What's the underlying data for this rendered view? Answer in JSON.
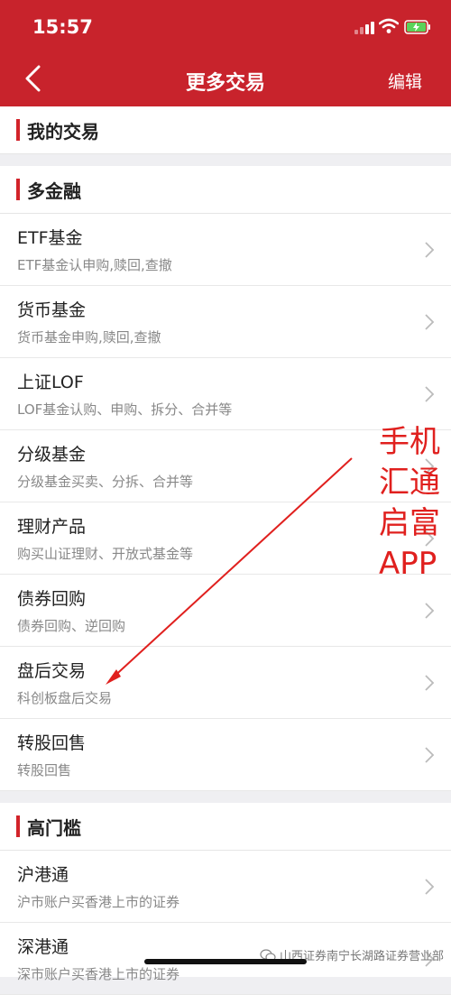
{
  "status_bar": {
    "time": "15:57"
  },
  "nav": {
    "title": "更多交易",
    "edit_label": "编辑"
  },
  "sections": [
    {
      "title": "我的交易",
      "items": []
    },
    {
      "title": "多金融",
      "items": [
        {
          "name": "ETF基金",
          "desc": "ETF基金认申购,赎回,查撤"
        },
        {
          "name": "货币基金",
          "desc": "货币基金申购,赎回,查撤"
        },
        {
          "name": "上证LOF",
          "desc": "LOF基金认购、申购、拆分、合并等"
        },
        {
          "name": "分级基金",
          "desc": "分级基金买卖、分拆、合并等"
        },
        {
          "name": "理财产品",
          "desc": "购买山证理财、开放式基金等"
        },
        {
          "name": "债券回购",
          "desc": "债券回购、逆回购"
        },
        {
          "name": "盘后交易",
          "desc": "科创板盘后交易"
        },
        {
          "name": "转股回售",
          "desc": "转股回售"
        }
      ]
    },
    {
      "title": "高门槛",
      "items": [
        {
          "name": "沪港通",
          "desc": "沪市账户买香港上市的证券"
        },
        {
          "name": "深港通",
          "desc": "深市账户买香港上市的证券"
        }
      ]
    }
  ],
  "annotation": {
    "lines": [
      "手机",
      "汇通",
      "启富",
      "APP"
    ]
  },
  "watermark": {
    "text": "山西证券南宁长湖路证券营业部"
  },
  "colors": {
    "header": "#c8232c",
    "accent_bar": "#d2232a",
    "annotation": "#e0201e"
  }
}
